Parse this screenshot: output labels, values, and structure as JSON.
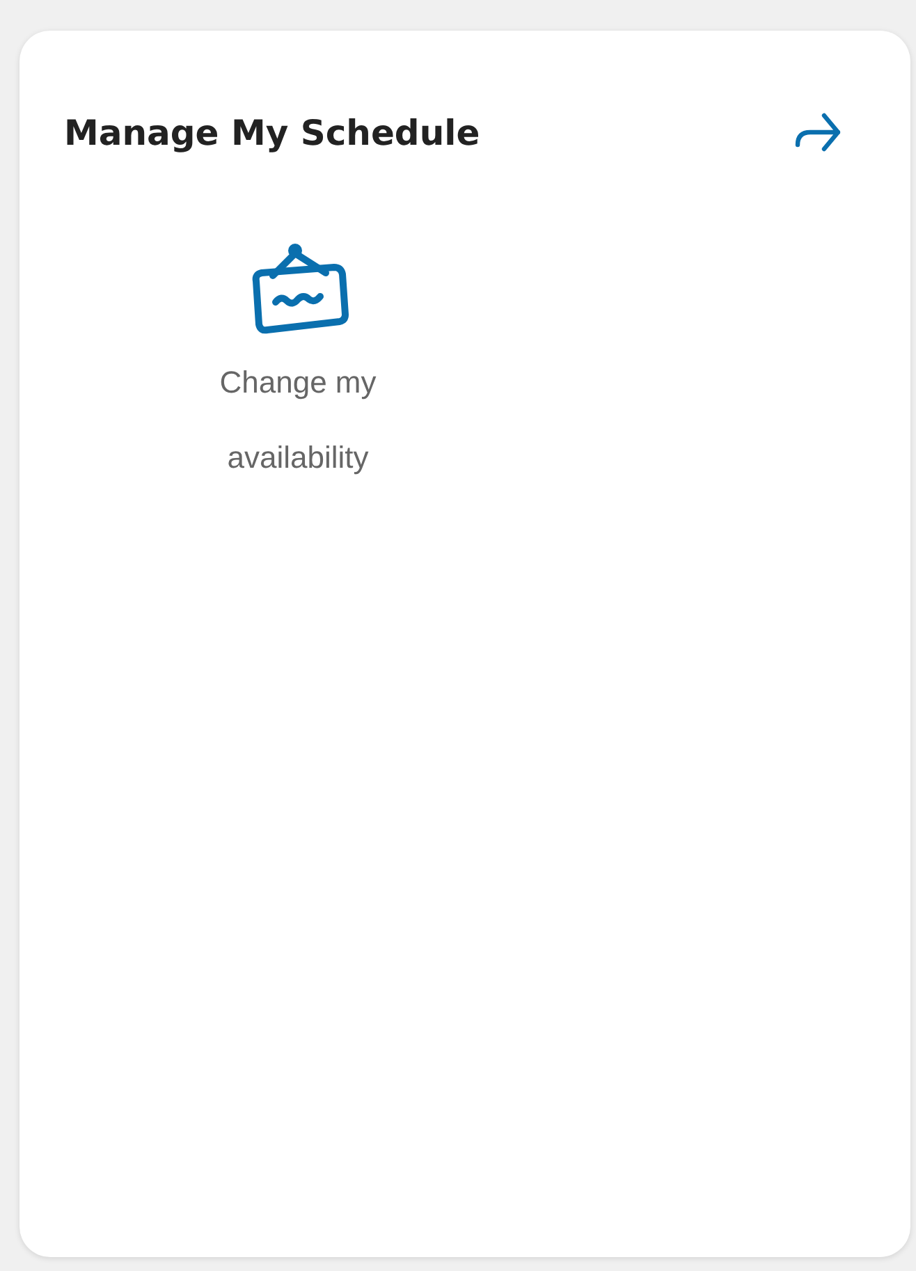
{
  "card": {
    "title": "Manage My Schedule"
  },
  "actions": [
    {
      "label": "Change my availability",
      "kind": "sign"
    }
  ]
}
